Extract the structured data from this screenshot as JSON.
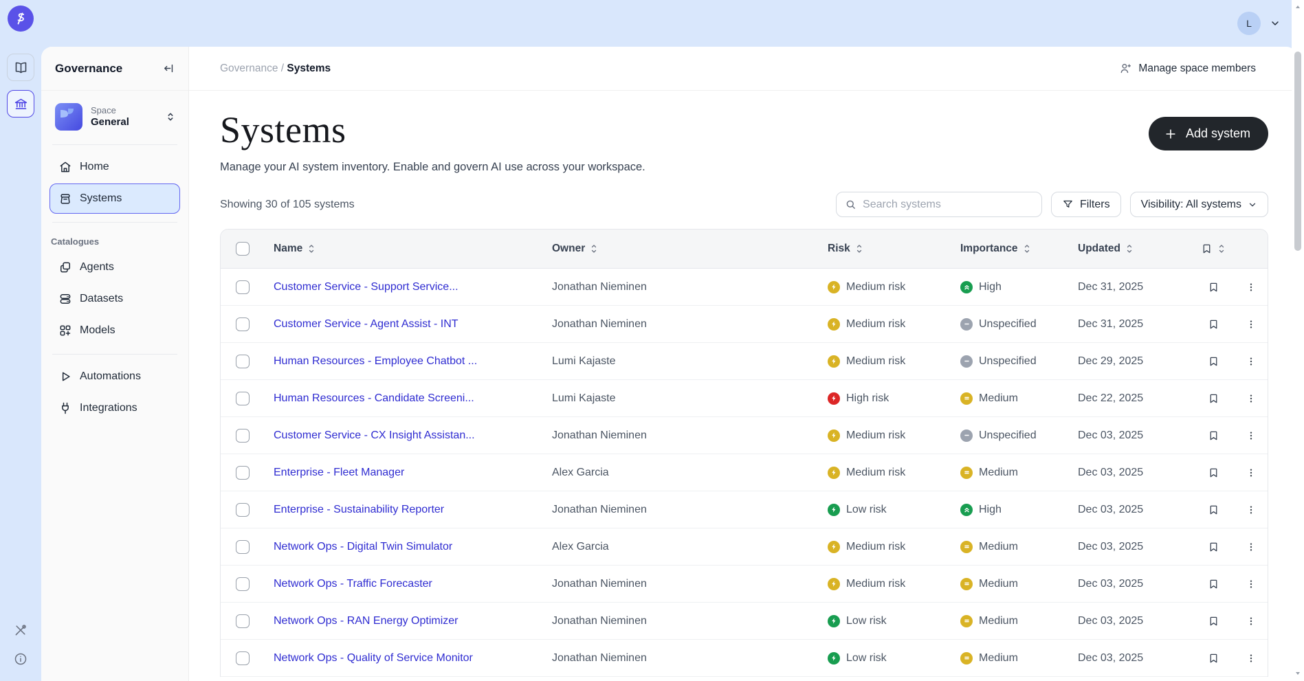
{
  "rail": {
    "logo_icon": "brand-logo-icon",
    "buttons": [
      {
        "icon": "book-icon",
        "active": false
      },
      {
        "icon": "bank-icon",
        "active": true
      }
    ],
    "bottom_icons": [
      "tools-icon",
      "info-icon"
    ]
  },
  "sidebar": {
    "title": "Governance",
    "collapse_icon": "collapse-sidebar-icon",
    "space": {
      "label": "Space",
      "name": "General"
    },
    "nav_main": [
      {
        "label": "Home",
        "icon": "home-icon",
        "active": false
      },
      {
        "label": "Systems",
        "icon": "systems-icon",
        "active": true
      }
    ],
    "catalogues_section": {
      "label": "Catalogues",
      "items": [
        {
          "label": "Agents",
          "icon": "agents-icon"
        },
        {
          "label": "Datasets",
          "icon": "datasets-icon"
        },
        {
          "label": "Models",
          "icon": "models-icon"
        }
      ]
    },
    "nav_bottom": [
      {
        "label": "Automations",
        "icon": "automations-icon"
      },
      {
        "label": "Integrations",
        "icon": "integrations-icon"
      }
    ]
  },
  "topbar": {
    "avatar_initial": "L"
  },
  "breadcrumb": {
    "parent": "Governance",
    "separator": " / ",
    "current": "Systems"
  },
  "header": {
    "manage_members_label": "Manage space members",
    "title": "Systems",
    "description": "Manage your AI system inventory. Enable and govern AI use across your workspace.",
    "add_button_label": "Add system"
  },
  "toolbar": {
    "showing_text": "Showing 30 of 105 systems",
    "search_placeholder": "Search systems",
    "filters_label": "Filters",
    "visibility_label": "Visibility: All systems"
  },
  "table": {
    "columns": {
      "name": "Name",
      "owner": "Owner",
      "risk": "Risk",
      "importance": "Importance",
      "updated": "Updated"
    },
    "rows": [
      {
        "name": "Customer Service - Support Service...",
        "owner": "Jonathan Nieminen",
        "risk": "Medium risk",
        "risk_level": "medium",
        "importance": "High",
        "importance_level": "high",
        "updated": "Dec 31, 2025"
      },
      {
        "name": "Customer Service - Agent Assist - INT",
        "owner": "Jonathan Nieminen",
        "risk": "Medium risk",
        "risk_level": "medium",
        "importance": "Unspecified",
        "importance_level": "unspecified",
        "updated": "Dec 31, 2025"
      },
      {
        "name": "Human Resources - Employee Chatbot ...",
        "owner": "Lumi Kajaste",
        "risk": "Medium risk",
        "risk_level": "medium",
        "importance": "Unspecified",
        "importance_level": "unspecified",
        "updated": "Dec 29, 2025"
      },
      {
        "name": "Human Resources - Candidate Screeni...",
        "owner": "Lumi Kajaste",
        "risk": "High risk",
        "risk_level": "high",
        "importance": "Medium",
        "importance_level": "medium",
        "updated": "Dec 22, 2025"
      },
      {
        "name": "Customer Service - CX Insight Assistan...",
        "owner": "Jonathan Nieminen",
        "risk": "Medium risk",
        "risk_level": "medium",
        "importance": "Unspecified",
        "importance_level": "unspecified",
        "updated": "Dec 03, 2025"
      },
      {
        "name": "Enterprise - Fleet Manager",
        "owner": "Alex Garcia",
        "risk": "Medium risk",
        "risk_level": "medium",
        "importance": "Medium",
        "importance_level": "medium",
        "updated": "Dec 03, 2025"
      },
      {
        "name": "Enterprise - Sustainability Reporter",
        "owner": "Jonathan Nieminen",
        "risk": "Low risk",
        "risk_level": "low",
        "importance": "High",
        "importance_level": "high",
        "updated": "Dec 03, 2025"
      },
      {
        "name": "Network Ops - Digital Twin Simulator",
        "owner": "Alex Garcia",
        "risk": "Medium risk",
        "risk_level": "medium",
        "importance": "Medium",
        "importance_level": "medium",
        "updated": "Dec 03, 2025"
      },
      {
        "name": "Network Ops - Traffic Forecaster",
        "owner": "Jonathan Nieminen",
        "risk": "Medium risk",
        "risk_level": "medium",
        "importance": "Medium",
        "importance_level": "medium",
        "updated": "Dec 03, 2025"
      },
      {
        "name": "Network Ops - RAN Energy Optimizer",
        "owner": "Jonathan Nieminen",
        "risk": "Low risk",
        "risk_level": "low",
        "importance": "Medium",
        "importance_level": "medium",
        "updated": "Dec 03, 2025"
      },
      {
        "name": "Network Ops - Quality of Service Monitor",
        "owner": "Jonathan Nieminen",
        "risk": "Low risk",
        "risk_level": "low",
        "importance": "Medium",
        "importance_level": "medium",
        "updated": "Dec 03, 2025"
      }
    ]
  },
  "colors": {
    "page_bg": "#d9e7fc",
    "brand": "#5a52e8",
    "accent_indigo": "#4f46e5",
    "link_blue": "#2f2cd1",
    "active_nav_bg": "#dbeafe",
    "risk_low": "#189d50",
    "risk_medium": "#d9b325",
    "risk_high": "#dc2626",
    "importance_high": "#189d50",
    "importance_medium": "#d9b325",
    "importance_unspecified": "#9ca3af",
    "add_button_bg": "#22262b"
  }
}
